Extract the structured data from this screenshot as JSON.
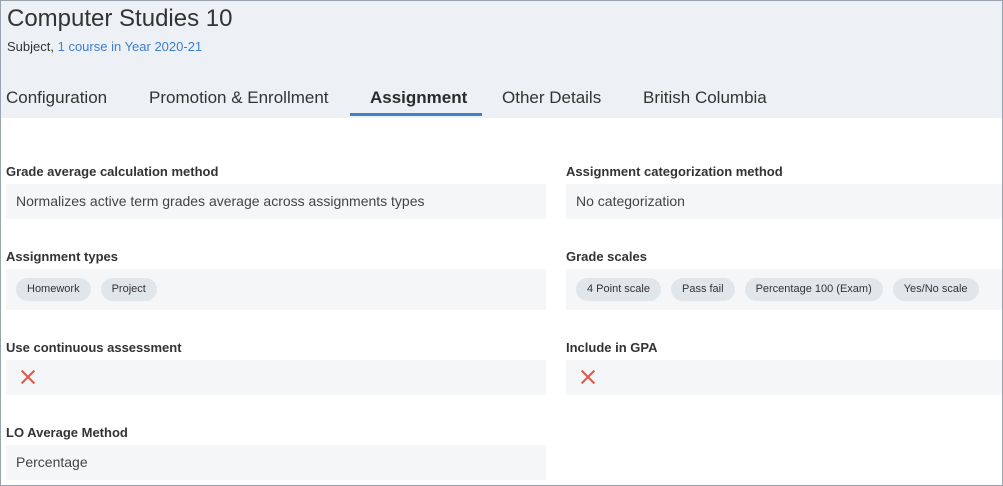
{
  "header": {
    "title": "Computer Studies 10",
    "subtitle_prefix": "Subject,",
    "subtitle_link": "1 course in Year 2020-21"
  },
  "tabs": [
    {
      "label": "Configuration"
    },
    {
      "label": "Promotion & Enrollment"
    },
    {
      "label": "Assignment"
    },
    {
      "label": "Other Details"
    },
    {
      "label": "British Columbia"
    }
  ],
  "active_tab": "Assignment",
  "fields": {
    "grade_average": {
      "label": "Grade average calculation method",
      "value": "Normalizes active term grades average across assignments types"
    },
    "assignment_categorization": {
      "label": "Assignment categorization method",
      "value": "No categorization"
    },
    "assignment_types": {
      "label": "Assignment types",
      "chips": [
        "Homework",
        "Project"
      ]
    },
    "grade_scales": {
      "label": "Grade scales",
      "chips": [
        "4 Point scale",
        "Pass fail",
        "Percentage 100 (Exam)",
        "Yes/No scale"
      ]
    },
    "continuous_assessment": {
      "label": "Use continuous assessment",
      "icon": "close-icon"
    },
    "include_gpa": {
      "label": "Include in GPA",
      "icon": "close-icon"
    },
    "lo_average": {
      "label": "LO Average Method",
      "value": "Percentage"
    }
  },
  "colors": {
    "header_bg": "#edf1f5",
    "link": "#3b7fd0",
    "tab_underline": "#3b82c9",
    "cross": "#e2554a"
  }
}
